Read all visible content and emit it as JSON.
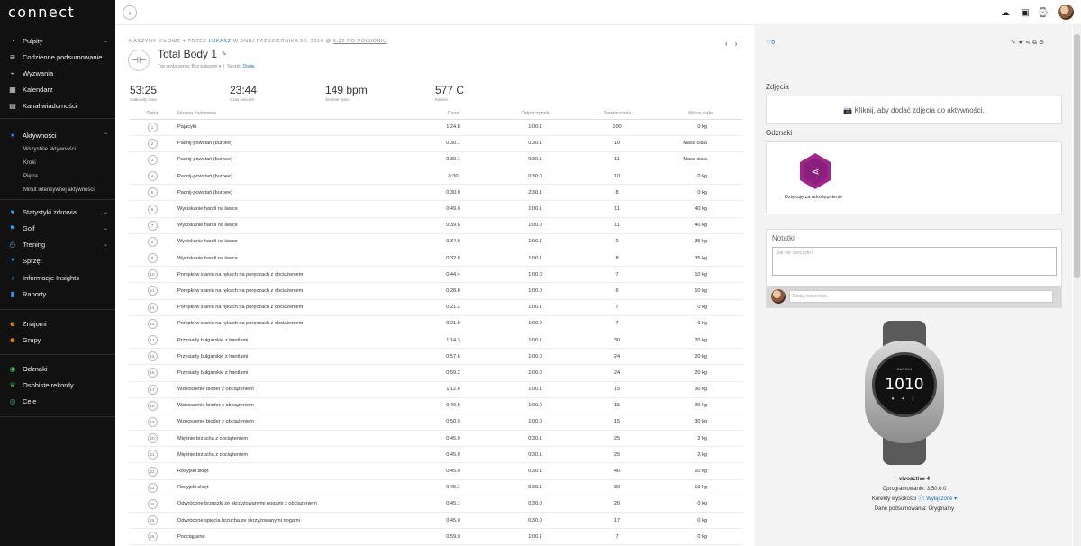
{
  "brand": "connect",
  "sidebar": {
    "items": [
      {
        "label": "Pulpity",
        "icon": "dashboard-icon",
        "chevron": true
      },
      {
        "label": "Codzienne podsumowanie",
        "icon": "layers-icon"
      },
      {
        "label": "Wyzwania",
        "icon": "challenge-icon"
      },
      {
        "label": "Kalendarz",
        "icon": "calendar-icon"
      },
      {
        "label": "Kanał wiadomości",
        "icon": "news-icon"
      },
      {
        "label": "Aktywności",
        "icon": "activity-icon",
        "chevron": true
      },
      {
        "label": "Statystyki zdrowia",
        "icon": "heart-icon",
        "chevron": true
      },
      {
        "label": "Golf",
        "icon": "golf-icon",
        "chevron": true
      },
      {
        "label": "Trening",
        "icon": "stopwatch-icon",
        "chevron": true
      },
      {
        "label": "Sprzęt",
        "icon": "shoe-icon"
      },
      {
        "label": "Informacje Insights",
        "icon": "bulb-icon"
      },
      {
        "label": "Raporty",
        "icon": "bar-chart-icon"
      },
      {
        "label": "Znajomi",
        "icon": "friends-icon"
      },
      {
        "label": "Grupy",
        "icon": "groups-icon"
      },
      {
        "label": "Odznaki",
        "icon": "badge-icon"
      },
      {
        "label": "Osobiste rekordy",
        "icon": "trophy-icon"
      },
      {
        "label": "Cele",
        "icon": "target-icon"
      }
    ],
    "sub_items": [
      "Wszystkie aktywności",
      "Kroki",
      "Piętra",
      "Minut intensywnej aktywności"
    ]
  },
  "header": {
    "crumb_type": "MASZYNY SIŁOWE",
    "crumb_by": "PRZEZ",
    "crumb_user": "LUKASZ",
    "crumb_date": "W DNIU PAŹDZIERNIKA 30, 2019 @",
    "crumb_time": "5:22 PO POŁUDNIU",
    "title": "Total Body 1",
    "event_type_label": "Typ wydarzenia:",
    "event_type_value": "Bez kategorii ▾",
    "gear_label": "Sprzęt:",
    "gear_link": "Dodaj",
    "like_count": "0"
  },
  "stats": [
    {
      "value": "53:25",
      "label": "Całkowity czas"
    },
    {
      "value": "23:44",
      "label": "Czas ćwiczeń"
    },
    {
      "value": "149 bpm",
      "label": "Średnie tętno"
    },
    {
      "value": "577 C",
      "label": "Kalorie"
    }
  ],
  "table": {
    "headers": [
      "Seria",
      "Nazwa ćwiczenia",
      "Czas",
      "Odpoczynek",
      "Powtórzenia",
      "Masa ciała"
    ],
    "rows": [
      [
        "1",
        "Pajacyki",
        "1:24.8",
        "1:00.1",
        "100",
        "0 kg"
      ],
      [
        "2",
        "Padnij-powstań (burpee)",
        "0:30.1",
        "0:30.1",
        "10",
        "Masa ciała"
      ],
      [
        "3",
        "Padnij-powstań (burpee)",
        "0:30.1",
        "0:30.1",
        "11",
        "Masa ciała"
      ],
      [
        "4",
        "Padnij-powstań (burpee)",
        "0:30",
        "0:30.0",
        "10",
        "0 kg"
      ],
      [
        "5",
        "Padnij-powstań (burpee)",
        "0:30.0",
        "2:30.1",
        "8",
        "0 kg"
      ],
      [
        "6",
        "Wyciskanie hantli na ławce",
        "0:49.0",
        "1:00.1",
        "11",
        "40 kg"
      ],
      [
        "7",
        "Wyciskanie hantli na ławce",
        "0:39.6",
        "1:00.0",
        "11",
        "40 kg"
      ],
      [
        "8",
        "Wyciskanie hantli na ławce",
        "0:34.0",
        "1:00.1",
        "9",
        "35 kg"
      ],
      [
        "9",
        "Wyciskanie hantli na ławce",
        "0:32.8",
        "1:00.1",
        "8",
        "35 kg"
      ],
      [
        "10",
        "Pompki w staniu na rękach na poręczach z obciążeniem",
        "0:44.4",
        "1:00.0",
        "7",
        "10 kg"
      ],
      [
        "11",
        "Pompki w staniu na rękach na poręczach z obciążeniem",
        "0:28.8",
        "1:00.0",
        "6",
        "10 kg"
      ],
      [
        "12",
        "Pompki w staniu na rękach na poręczach z obciążeniem",
        "0:21.2",
        "1:00.1",
        "7",
        "0 kg"
      ],
      [
        "13",
        "Pompki w staniu na rękach na poręczach z obciążeniem",
        "0:21.9",
        "1:00.0",
        "7",
        "0 kg"
      ],
      [
        "14",
        "Przysiady bułgarskie z hantlami",
        "1:14.3",
        "1:00.1",
        "30",
        "20 kg"
      ],
      [
        "15",
        "Przysiady bułgarskie z hantlami",
        "0:57.6",
        "1:00.0",
        "24",
        "20 kg"
      ],
      [
        "16",
        "Przysiady bułgarskie z hantlami",
        "0:59.2",
        "1:00.0",
        "24",
        "20 kg"
      ],
      [
        "17",
        "Wznoszenie bioder z obciążeniem",
        "1:12.6",
        "1:00.1",
        "15",
        "30 kg"
      ],
      [
        "18",
        "Wznoszenie bioder z obciążeniem",
        "0:40.8",
        "1:00.0",
        "15",
        "30 kg"
      ],
      [
        "19",
        "Wznoszenie bioder z obciążeniem",
        "0:50.9",
        "1:00.0",
        "15",
        "30 kg"
      ],
      [
        "20",
        "Mięśnie brzucha z obciążeniem",
        "0:45.0",
        "0:30.1",
        "25",
        "2 kg"
      ],
      [
        "21",
        "Mięśnie brzucha z obciążeniem",
        "0:45.0",
        "0:30.1",
        "25",
        "2 kg"
      ],
      [
        "22",
        "Rosyjski skręt",
        "0:45.0",
        "0:30.1",
        "40",
        "10 kg"
      ],
      [
        "23",
        "Rosyjski skręt",
        "0:45.1",
        "0:30.1",
        "30",
        "10 kg"
      ],
      [
        "24",
        "Odwrócone brzuszki ze skrzyżowanymi nogami z obciążeniem",
        "0:45.1",
        "0:30.0",
        "20",
        "0 kg"
      ],
      [
        "25",
        "Odwrócone spięcia brzucha ze skrzyżowanymi nogami",
        "0:45.0",
        "0:30.0",
        "17",
        "0 kg"
      ],
      [
        "26",
        "Podciąganie",
        "0:59.0",
        "1:00.1",
        "7",
        "0 kg"
      ]
    ]
  },
  "right_panel": {
    "photos_title": "Zdjęcia",
    "photos_cta": "Kliknij, aby dodać zdjęcia do aktywności.",
    "badges_title": "Odznaki",
    "badge_label": "Dziękuję za udostępnienie",
    "notes_title": "Notatki",
    "notes_placeholder": "Jak się ćwiczyło?",
    "comment_placeholder": "Dodaj komentarz."
  },
  "device": {
    "name": "vivoactive 4",
    "firmware": "Oprogramowanie: 3.50.0.0",
    "elevation_label": "Korekty wysokości",
    "elevation_value": "Wyłączone ▾",
    "summary": "Dane podsumowania: Oryginalny",
    "face_brand": "GARMIN",
    "face_time": "1010"
  },
  "colors": {
    "sidebar_bg": "#111111",
    "link": "#1a73b8",
    "badge": "#a0258f"
  }
}
